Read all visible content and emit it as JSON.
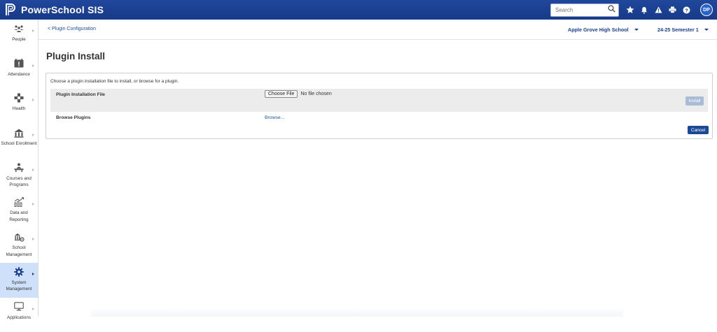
{
  "app": {
    "title": "PowerSchool SIS",
    "brand_color": "#1b3f8f"
  },
  "topbar": {
    "search_placeholder": "Search",
    "icons": [
      "search-icon",
      "star-icon",
      "bell-icon",
      "alert-icon",
      "print-icon",
      "help-icon"
    ],
    "avatar_initials": "DP"
  },
  "sidebar": {
    "items": [
      {
        "label": "People",
        "icon": "people-icon",
        "active": false
      },
      {
        "label": "Attendance",
        "icon": "attendance-icon",
        "active": false
      },
      {
        "label": "Health",
        "icon": "health-icon",
        "active": false
      },
      {
        "label": "School Enrollment",
        "icon": "enrollment-icon",
        "active": false
      },
      {
        "label": "Courses and Programs",
        "icon": "courses-icon",
        "active": false
      },
      {
        "label": "Data and Reporting",
        "icon": "reporting-icon",
        "active": false
      },
      {
        "label": "School Management",
        "icon": "school-management-icon",
        "active": false
      },
      {
        "label": "System Management",
        "icon": "gear-icon",
        "active": true
      },
      {
        "label": "Applications",
        "icon": "monitor-icon",
        "active": false
      }
    ]
  },
  "subheader": {
    "breadcrumb": "< Plugin Configuration",
    "school": "Apple Grove High School",
    "term": "24-25 Semester 1"
  },
  "main": {
    "title": "Plugin Install",
    "instructions": "Choose a plugin installation file to install, or browse for a plugin.",
    "file_label": "Plugin Installation File",
    "choose_file_label": "Choose File",
    "file_status": "No file chosen",
    "install_label": "Install",
    "browse_label": "Browse Plugins",
    "browse_link": "Browse...",
    "cancel_label": "Cancel"
  }
}
